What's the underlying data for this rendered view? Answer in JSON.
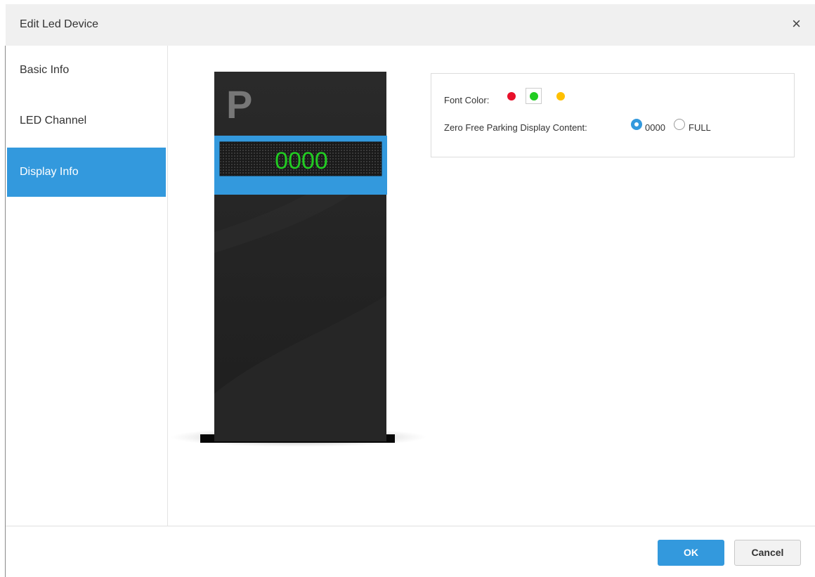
{
  "dialog": {
    "title": "Edit Led Device",
    "close_glyph": "×"
  },
  "nav": {
    "items": [
      {
        "label": "Basic Info",
        "active": false
      },
      {
        "label": "LED Channel",
        "active": false
      },
      {
        "label": "Display Info",
        "active": true
      }
    ]
  },
  "preview": {
    "logo_letter": "P",
    "display_value": "0000",
    "display_color": "#22cc22"
  },
  "settings": {
    "font_color_label": "Font Color:",
    "font_colors": [
      {
        "name": "red",
        "hex": "#e8102a",
        "selected": false
      },
      {
        "name": "green",
        "hex": "#22cc22",
        "selected": true
      },
      {
        "name": "yellow",
        "hex": "#ffc000",
        "selected": false
      }
    ],
    "zero_free_label": "Zero Free Parking Display Content:",
    "zero_free_options": [
      {
        "label": "0000",
        "selected": true
      },
      {
        "label": "FULL",
        "selected": false
      }
    ]
  },
  "footer": {
    "ok_label": "OK",
    "cancel_label": "Cancel"
  },
  "colors": {
    "accent": "#3399dd"
  }
}
